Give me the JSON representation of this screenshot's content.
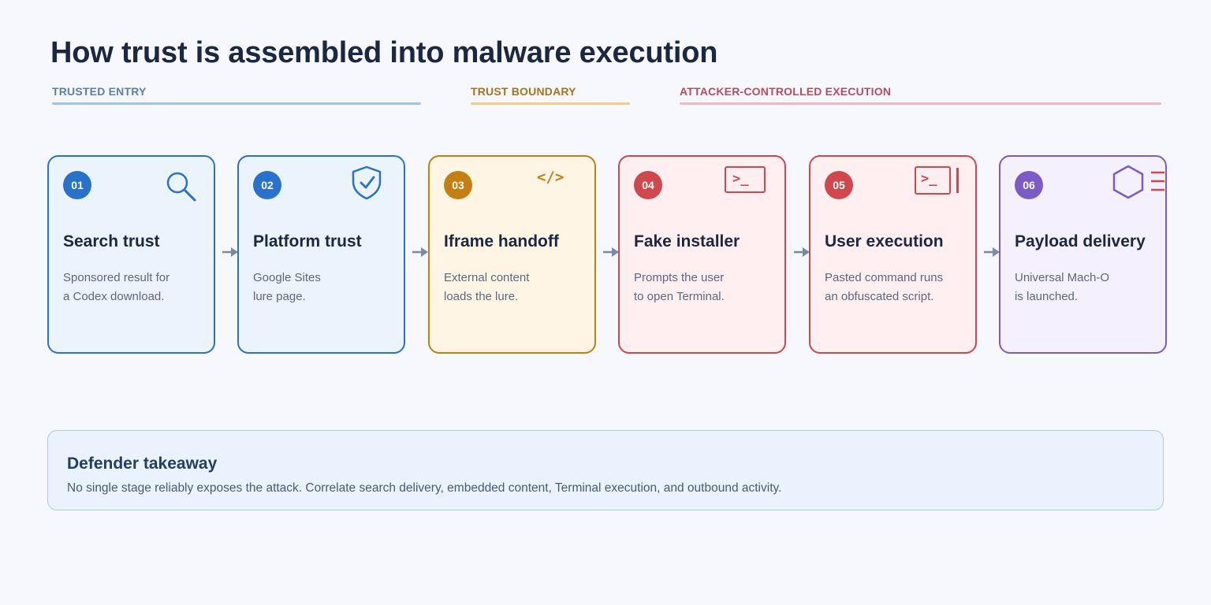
{
  "title": "How trust is assembled into malware execution",
  "bands": [
    {
      "label": "TRUSTED ENTRY",
      "color": "#5d7fa6",
      "rule": "#9cc6ee"
    },
    {
      "label": "TRUST BOUNDARY",
      "color": "#a7731a",
      "rule": "#f0cd86"
    },
    {
      "label": "ATTACKER-CONTROLLED EXECUTION",
      "color": "#b24f5c",
      "rule": "#f2b6c0"
    }
  ],
  "stages": [
    {
      "num": "01",
      "title": "Search trust",
      "desc": [
        "Sponsored result for",
        "a Codex download."
      ],
      "icon": "search-icon",
      "accent": "#2872c9",
      "fill": "#ebf3fd"
    },
    {
      "num": "02",
      "title": "Platform trust",
      "desc": [
        "Google Sites",
        "lure page."
      ],
      "icon": "shield-check-icon",
      "accent": "#2872c9",
      "fill": "#ebf3fd"
    },
    {
      "num": "03",
      "title": "Iframe handoff",
      "desc": [
        "External content",
        "loads the lure."
      ],
      "icon": "code-icon",
      "icon_text": "</>",
      "accent": "#c47f10",
      "fill": "#fff5e5"
    },
    {
      "num": "04",
      "title": "Fake installer",
      "desc": [
        "Prompts the user",
        "to open Terminal."
      ],
      "icon": "terminal-icon",
      "icon_text": ">_",
      "accent": "#d0474d",
      "fill": "#ffeff1"
    },
    {
      "num": "05",
      "title": "User execution",
      "desc": [
        "Pasted command runs",
        "an obfuscated script."
      ],
      "icon": "terminal-cursor-icon",
      "icon_text": ">_",
      "accent": "#d0474d",
      "fill": "#ffeff1"
    },
    {
      "num": "06",
      "title": "Payload delivery",
      "desc": [
        "Universal Mach-O",
        "is launched."
      ],
      "icon": "hexagon-payload-icon",
      "accent": "#7d5bc4",
      "fill": "#f4f0fe"
    }
  ],
  "takeaway": {
    "title": "Defender takeaway",
    "body": "No single stage reliably exposes the attack. Correlate search delivery, embedded content, Terminal execution, and outbound activity."
  }
}
